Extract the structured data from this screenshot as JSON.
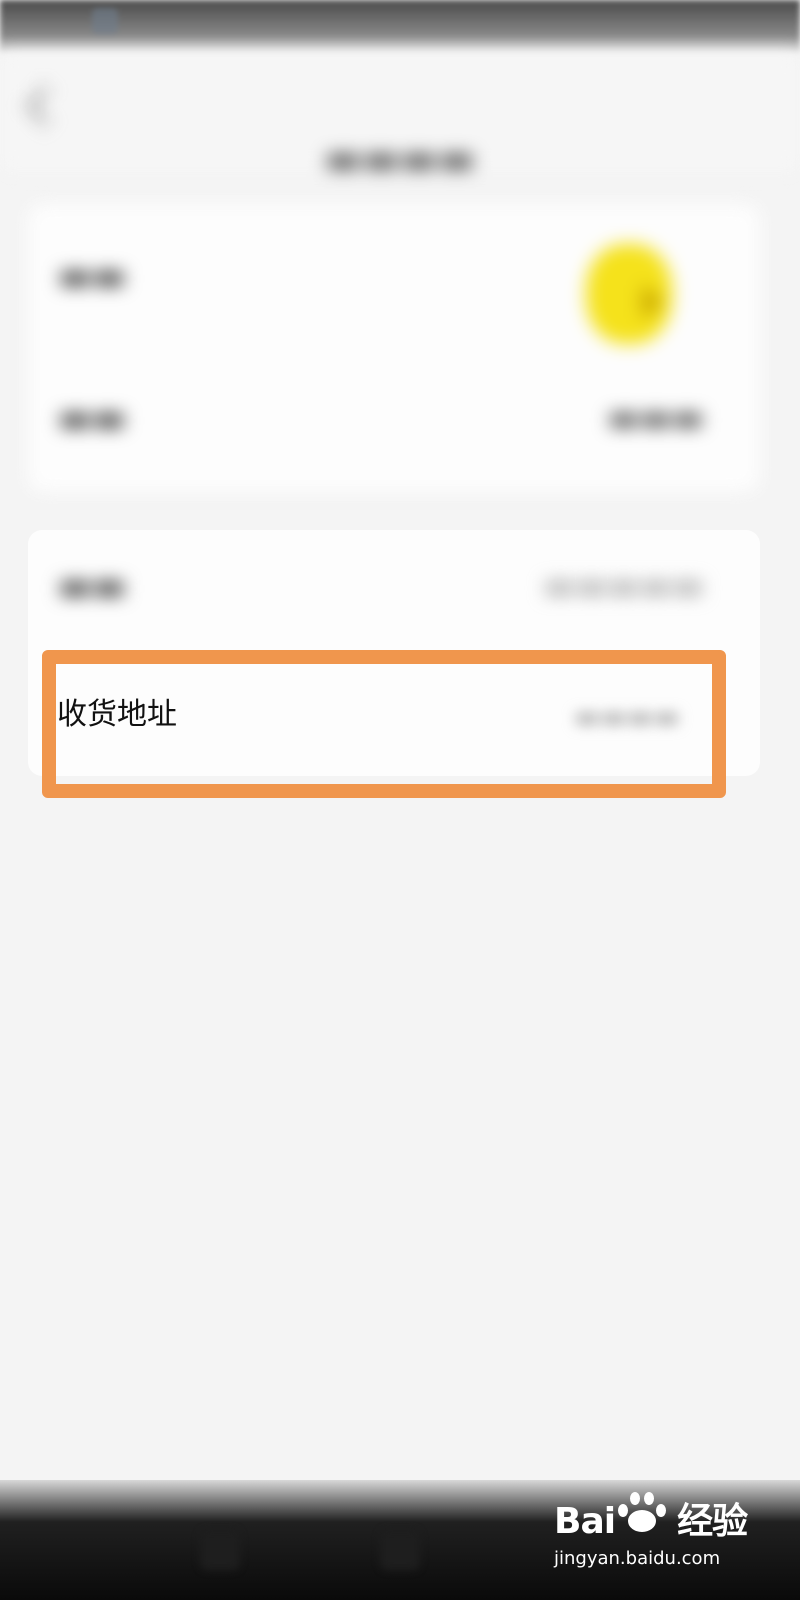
{
  "address_row": {
    "label": "收货地址"
  },
  "watermark": {
    "logo_text_1": "Bai",
    "logo_text_2": "经验",
    "url": "jingyan.baidu.com"
  },
  "colors": {
    "highlight": "#f0964d",
    "avatar": "#f5e21b"
  }
}
